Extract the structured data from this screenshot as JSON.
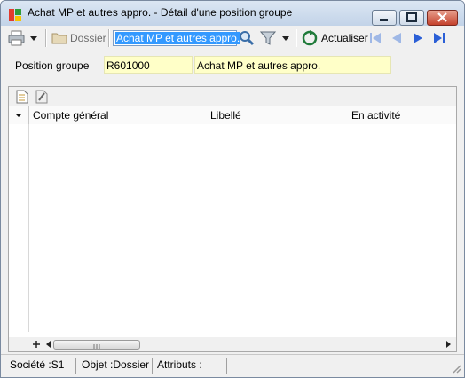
{
  "window": {
    "title": "Achat MP et autres appro. -  Détail d'une position groupe",
    "icons": {
      "app": "app-icon",
      "minimize": "minimize-icon",
      "maximize": "maximize-icon",
      "close": "close-icon"
    }
  },
  "toolbar": {
    "print_icon": "printer-icon",
    "folder_label": "Dossier",
    "search_value": "Achat MP et autres appro.",
    "search_icon": "magnifier-icon",
    "filter_icon": "filter-icon",
    "refresh_label": "Actualiser",
    "nav_icons": [
      "first-icon",
      "previous-icon",
      "next-icon",
      "last-icon"
    ],
    "nav_color": "#2b5fd6"
  },
  "form": {
    "position_label": "Position groupe",
    "position_code": "R601000",
    "position_name": "Achat MP et autres appro."
  },
  "grid": {
    "toolbar_icons": [
      "new-document-icon",
      "edit-document-icon"
    ],
    "columns": [
      "Compte général",
      "Libellé",
      "En activité"
    ],
    "rows": []
  },
  "statusbar": {
    "societe": "Société :S1",
    "objet": "Objet :Dossier",
    "attributs": "Attributs :"
  },
  "colors": {
    "field_bg": "#ffffc8",
    "selection": "#3399ff",
    "close_button": "#c4412c"
  }
}
